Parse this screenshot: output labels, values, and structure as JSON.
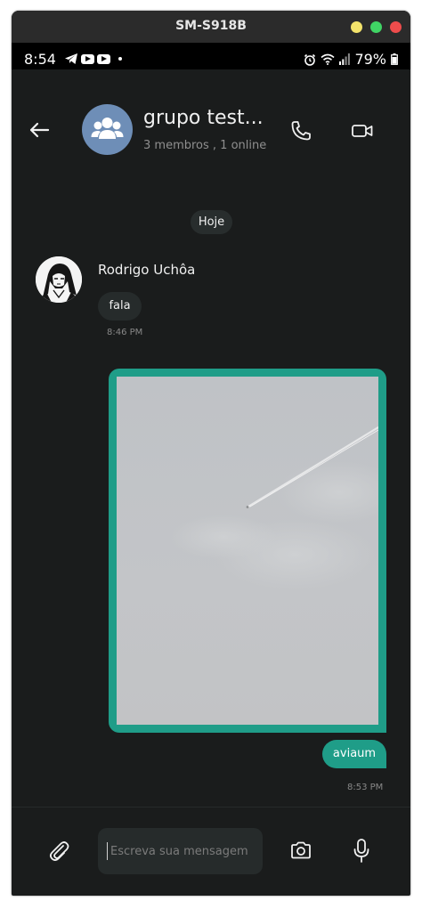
{
  "window": {
    "title": "SM-S918B"
  },
  "statusbar": {
    "time": "8:54",
    "battery": "79%"
  },
  "header": {
    "group_name": "grupo test...",
    "group_subtitle": "3 membros , 1 online",
    "avatar_color": "#6e8eb7"
  },
  "chat": {
    "date_label": "Hoje",
    "incoming": {
      "sender": "Rodrigo Uchôa",
      "text": "fala",
      "time": "8:46 PM"
    },
    "outgoing": {
      "text": "aviaum",
      "time": "8:53 PM",
      "bubble_color": "#1f9d88"
    }
  },
  "composer": {
    "placeholder": "Escreva sua mensagem"
  },
  "icons": [
    "back-arrow-icon",
    "group-icon",
    "phone-icon",
    "video-camera-icon",
    "paperclip-icon",
    "camera-icon",
    "microphone-icon",
    "telegram-icon",
    "youtube-icon",
    "alarm-icon",
    "wifi-icon",
    "signal-icon",
    "battery-icon"
  ]
}
